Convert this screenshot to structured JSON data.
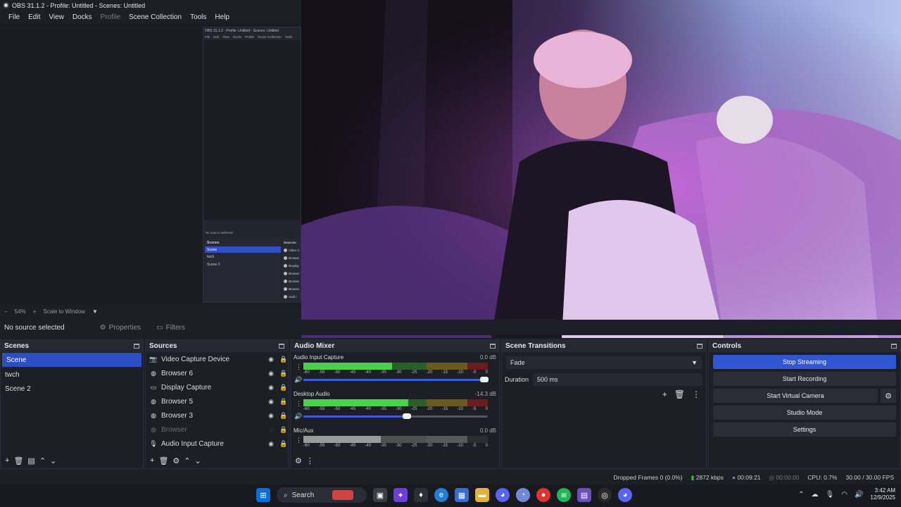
{
  "window": {
    "title": "OBS 31.1.2 - Profile: Untitled - Scenes: Untitled"
  },
  "menu": [
    "File",
    "Edit",
    "View",
    "Docks",
    "Profile",
    "Scene Collection",
    "Tools",
    "Help"
  ],
  "nested": {
    "title": "OBS 31.1.2 - Profile: Untitled - Scenes: Untitled",
    "menu": [
      "File",
      "Edit",
      "View",
      "Docks",
      "Profile",
      "Scene Collection",
      "Tools"
    ],
    "status": "No source selected",
    "scenes_header": "Scenes",
    "sources_header": "Sources",
    "scenes": [
      "Scene",
      "twch",
      "Scene 2"
    ],
    "sources": [
      "Video C",
      "Browse",
      "Display",
      "Browse",
      "Browse",
      "Browse",
      "Audi I"
    ]
  },
  "preview": {
    "zoom": "54%",
    "scale_mode": "Scale to Window"
  },
  "source_bar": {
    "status": "No source selected",
    "properties": "Properties",
    "filters": "Filters"
  },
  "scenes": {
    "title": "Scenes",
    "items": [
      "Scene",
      "twch",
      "Scene 2"
    ],
    "selected": 0
  },
  "sources": {
    "title": "Sources",
    "items": [
      {
        "label": "Video Capture Device",
        "icon": "camera-icon",
        "hidden": false
      },
      {
        "label": "Browser 6",
        "icon": "globe-icon",
        "hidden": false
      },
      {
        "label": "Display Capture",
        "icon": "monitor-icon",
        "hidden": false
      },
      {
        "label": "Browser 5",
        "icon": "globe-icon",
        "hidden": false
      },
      {
        "label": "Browser 3",
        "icon": "globe-icon",
        "hidden": false
      },
      {
        "label": "Browser",
        "icon": "globe-icon",
        "hidden": true
      },
      {
        "label": "Audio Input Capture",
        "icon": "mic-icon",
        "hidden": false
      }
    ]
  },
  "mixer": {
    "title": "Audio Mixer",
    "ticks": [
      "-60",
      "-55",
      "-50",
      "-45",
      "-40",
      "-35",
      "-30",
      "-25",
      "-20",
      "-15",
      "-10",
      "-5",
      "0"
    ],
    "channels": [
      {
        "name": "Audio Input Capture",
        "db": "0.0 dB",
        "level": 0.48,
        "volume": 0.98,
        "muted": false
      },
      {
        "name": "Desktop Audio",
        "db": "-14.3 dB",
        "level": 0.57,
        "volume": 0.56,
        "muted": false
      },
      {
        "name": "Mic/Aux",
        "db": "0.0 dB",
        "level": 0.42,
        "volume": 0.98,
        "muted": true
      }
    ]
  },
  "transitions": {
    "title": "Scene Transitions",
    "selected": "Fade",
    "duration_label": "Duration",
    "duration": "500 ms"
  },
  "controls": {
    "title": "Controls",
    "stop_streaming": "Stop Streaming",
    "start_recording": "Start Recording",
    "start_virtual_camera": "Start Virtual Camera",
    "studio_mode": "Studio Mode",
    "settings": "Settings"
  },
  "status": {
    "dropped": "Dropped Frames 0 (0.0%)",
    "bitrate": "2872 kbps",
    "live_time": "00:09:21",
    "rec_time": "00:00:00",
    "cpu": "CPU: 0.7%",
    "fps": "30.00 / 30.00 FPS"
  },
  "taskbar": {
    "search": "Search",
    "time": "3:42 AM",
    "date": "12/9/2025"
  },
  "colors": {
    "accent": "#3156d4",
    "meter_green": "#4ad14a",
    "bg": "#1d1f26"
  }
}
